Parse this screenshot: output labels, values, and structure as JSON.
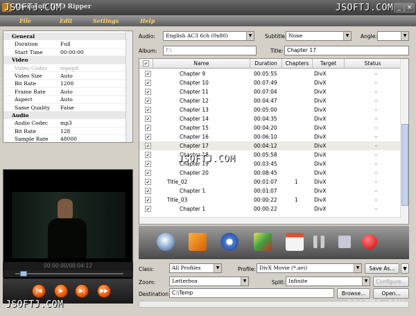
{
  "window": {
    "title": "Aberosoft DVD Ripper",
    "watermark": "JSOFTJ.COM"
  },
  "menu": [
    "File",
    "Edit",
    "Settings",
    "Help"
  ],
  "properties": [
    {
      "section": "General"
    },
    {
      "key": "Duration",
      "value": "Full"
    },
    {
      "key": "Start Time",
      "value": "00:00:00"
    },
    {
      "section": "Video"
    },
    {
      "key": "Video Codec",
      "value": "mpeg4",
      "disabled": true
    },
    {
      "key": "Video Size",
      "value": "Auto"
    },
    {
      "key": "Bit Rate",
      "value": "1200"
    },
    {
      "key": "Frame Rate",
      "value": "Auto"
    },
    {
      "key": "Aspect",
      "value": "Auto"
    },
    {
      "key": "Same Quality",
      "value": "False"
    },
    {
      "section": "Audio"
    },
    {
      "key": "Audio Codec",
      "value": "mp3"
    },
    {
      "key": "Bit Rate",
      "value": "128"
    },
    {
      "key": "Sample Rate",
      "value": "48000"
    }
  ],
  "preview": {
    "time": "00:00:00/00:04:12",
    "seek_fraction": 0.08
  },
  "top_fields": {
    "audio_label": "Audio:",
    "audio_value": "English AC3 6ch (0x80)",
    "subtitle_label": "Subtitle:",
    "subtitle_value": "None",
    "angle_label": "Angle:",
    "angle_value": "",
    "album_label": "Album:",
    "album_value": "F:\\",
    "title_label": "Title:",
    "title_value": "Chapter 17"
  },
  "table": {
    "columns": [
      "Name",
      "Duration",
      "Chapters",
      "Target",
      "Status"
    ],
    "rows": [
      {
        "name": "Chapter 9",
        "duration": "00:05:55",
        "chapters": "",
        "target": "DivX",
        "status": "-",
        "indent": 2
      },
      {
        "name": "Chapter 10",
        "duration": "00:07:49",
        "chapters": "",
        "target": "DivX",
        "status": "-",
        "indent": 2
      },
      {
        "name": "Chapter 11",
        "duration": "00:07:04",
        "chapters": "",
        "target": "DivX",
        "status": "-",
        "indent": 2
      },
      {
        "name": "Chapter 12",
        "duration": "00:04:47",
        "chapters": "",
        "target": "DivX",
        "status": "-",
        "indent": 2
      },
      {
        "name": "Chapter 13",
        "duration": "00:05:00",
        "chapters": "",
        "target": "DivX",
        "status": "-",
        "indent": 2
      },
      {
        "name": "Chapter 14",
        "duration": "00:04:35",
        "chapters": "",
        "target": "DivX",
        "status": "-",
        "indent": 2
      },
      {
        "name": "Chapter 15",
        "duration": "00:04:20",
        "chapters": "",
        "target": "DivX",
        "status": "-",
        "indent": 2
      },
      {
        "name": "Chapter 16",
        "duration": "00:06:10",
        "chapters": "",
        "target": "DivX",
        "status": "-",
        "indent": 2
      },
      {
        "name": "Chapter 17",
        "duration": "00:04:12",
        "chapters": "",
        "target": "DivX",
        "status": "-",
        "indent": 2,
        "selected": true
      },
      {
        "name": "Chapter 18",
        "duration": "00:05:58",
        "chapters": "",
        "target": "DivX",
        "status": "-",
        "indent": 2
      },
      {
        "name": "Chapter 19",
        "duration": "00:03:45",
        "chapters": "",
        "target": "DivX",
        "status": "-",
        "indent": 2
      },
      {
        "name": "Chapter 20",
        "duration": "00:08:45",
        "chapters": "",
        "target": "DivX",
        "status": "-",
        "indent": 2
      },
      {
        "name": "Title_02",
        "duration": "00:01:07",
        "chapters": "1",
        "target": "DivX",
        "status": "-",
        "indent": 1
      },
      {
        "name": "Chapter 1",
        "duration": "00:01:07",
        "chapters": "",
        "target": "DivX",
        "status": "-",
        "indent": 2
      },
      {
        "name": "Title_03",
        "duration": "00:00:22",
        "chapters": "1",
        "target": "DivX",
        "status": "-",
        "indent": 1
      },
      {
        "name": "Chapter 1",
        "duration": "00:00:22",
        "chapters": "",
        "target": "DivX",
        "status": "-",
        "indent": 2
      }
    ]
  },
  "toolbar_icons": [
    "dvd-load-icon",
    "import-icon",
    "settings-icon",
    "snapshot-icon",
    "chapter-list-icon",
    "pause-icon",
    "stop-icon",
    "record-icon"
  ],
  "bottom": {
    "class_label": "Class:",
    "class_value": "All Profiles",
    "profile_label": "Profile:",
    "profile_value": "DivX Movie  (*.avi)",
    "save_as": "Save As...",
    "zoom_label": "Zoom:",
    "zoom_value": "Letterbox",
    "split_label": "Split:",
    "split_value": "Infinite",
    "configure": "Configure...",
    "dest_label": "Destination:",
    "dest_value": "C:\\Temp",
    "browse": "Browse...",
    "open": "Open..."
  }
}
